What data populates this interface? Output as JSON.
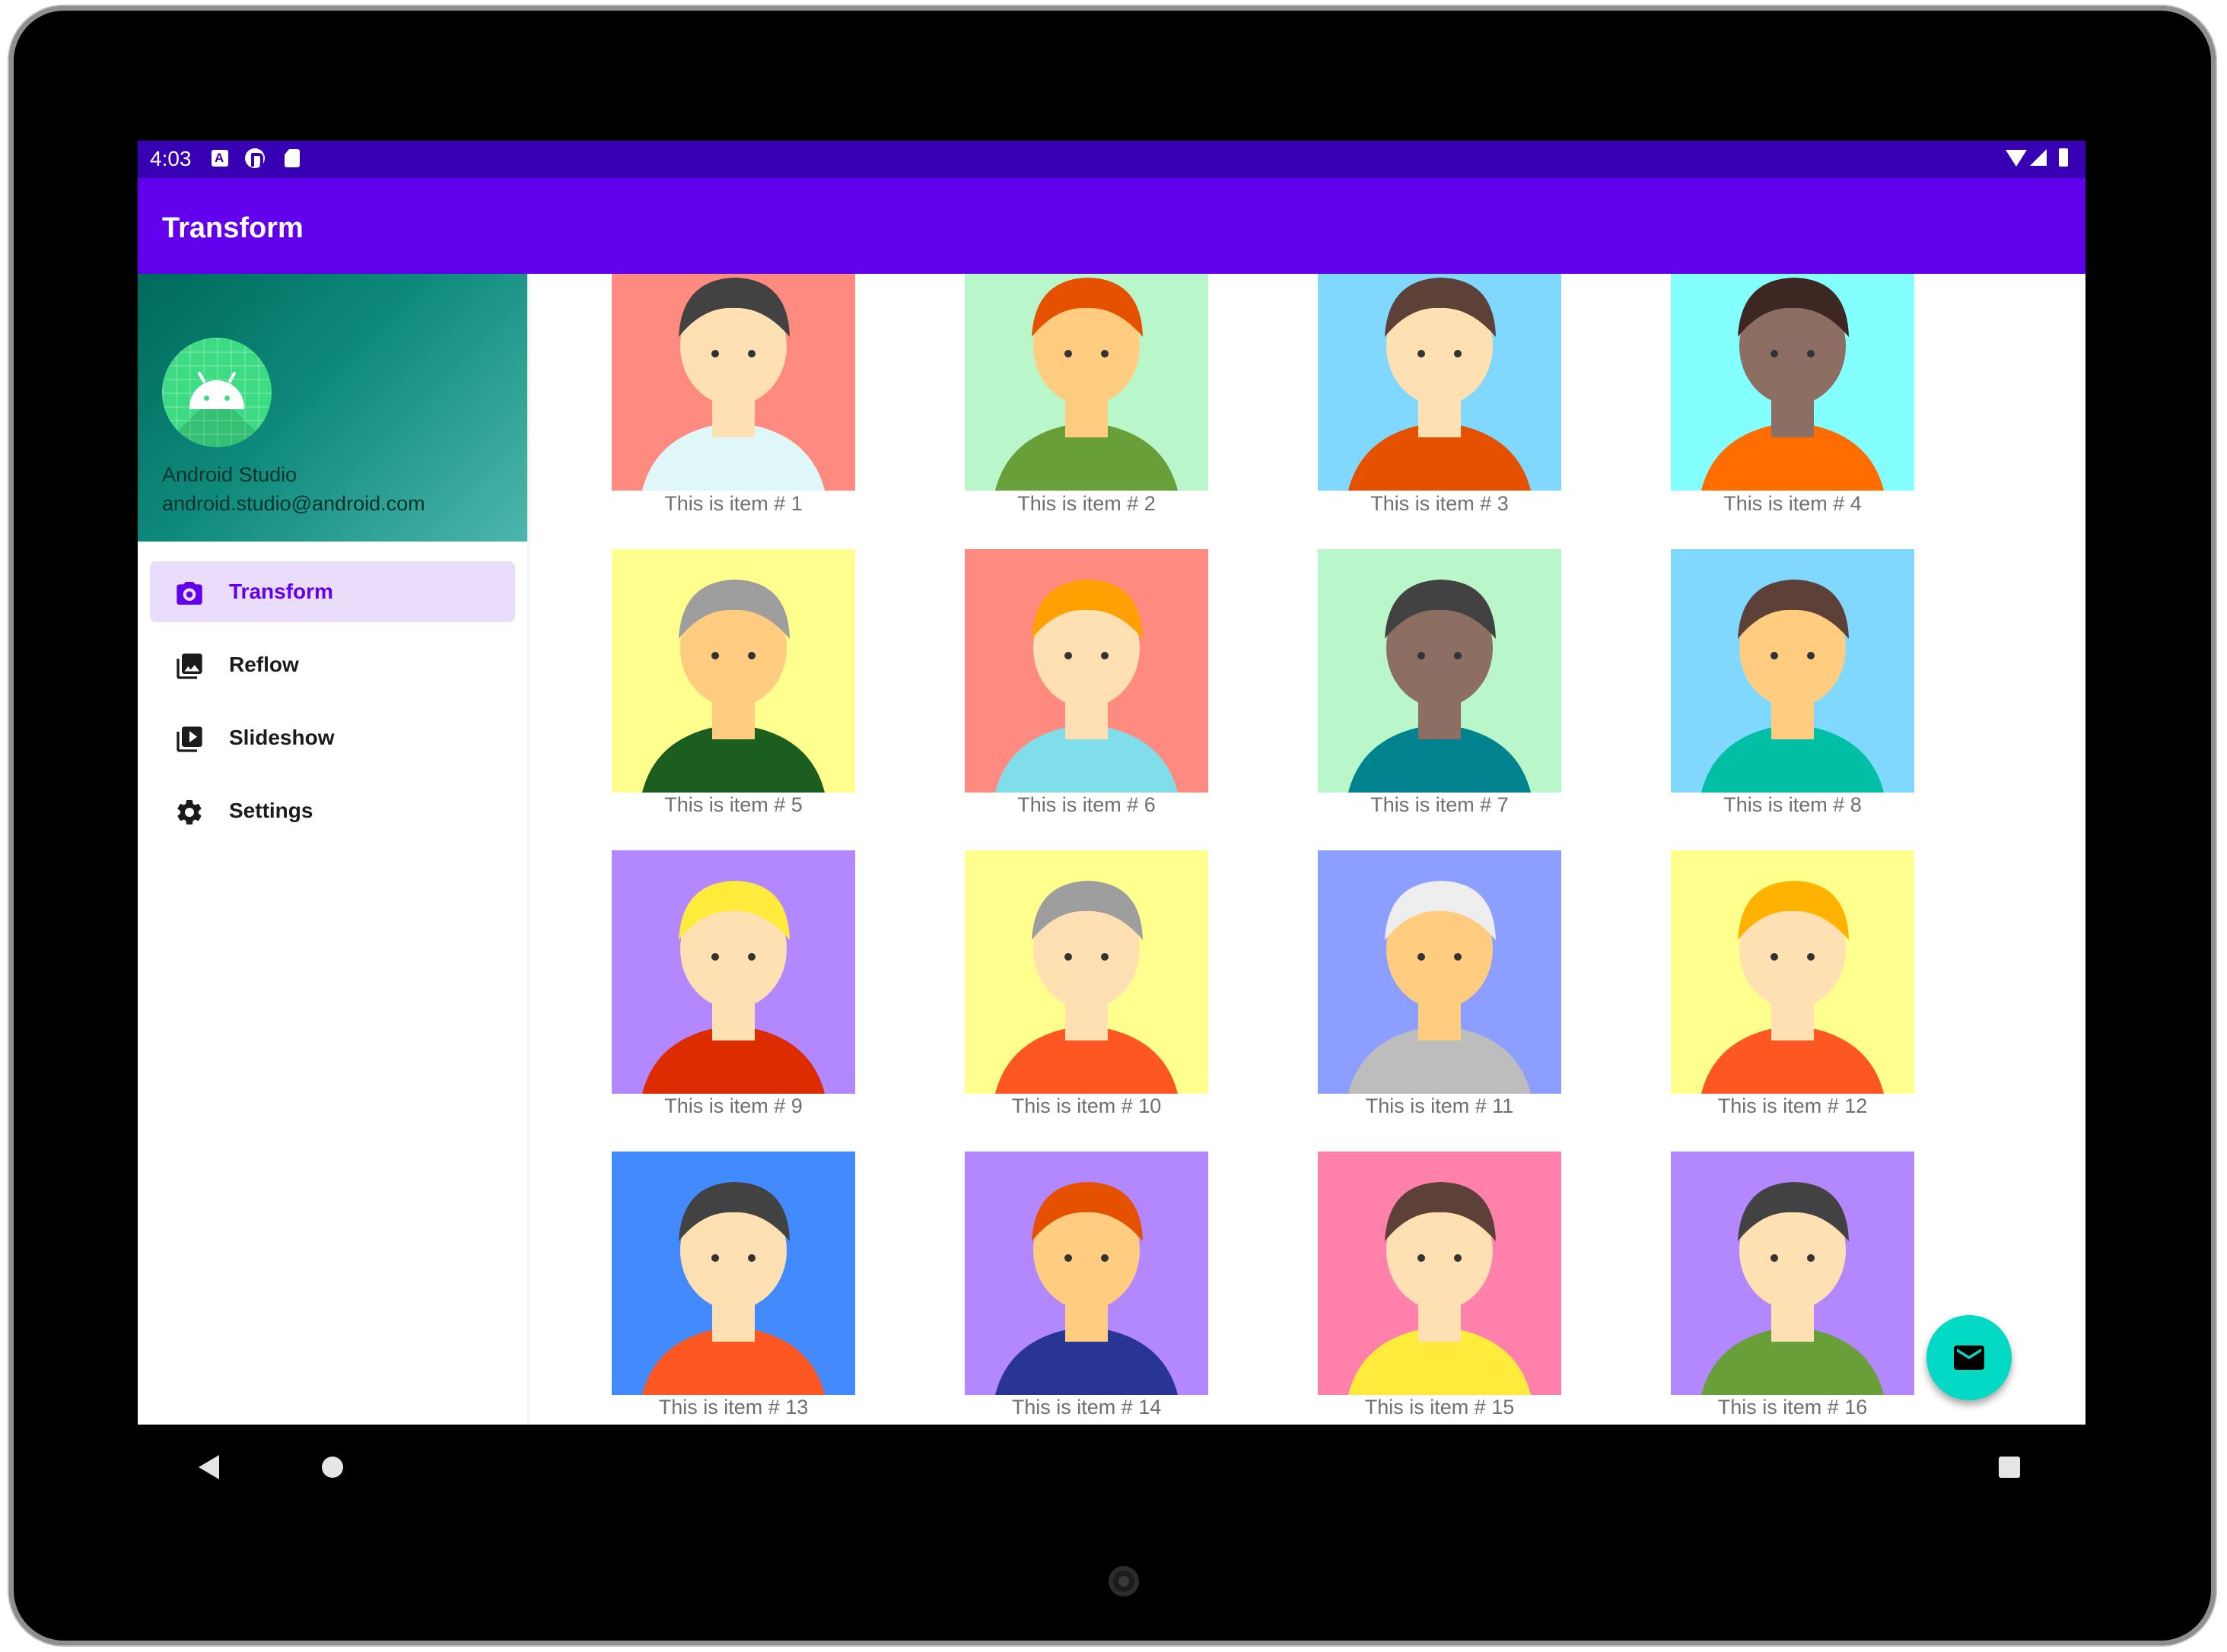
{
  "status_bar": {
    "time": "4:03",
    "left_icons": [
      "text-a-icon",
      "app-p-icon",
      "sd-card-icon"
    ],
    "right_icons": [
      "wifi-icon",
      "signal-icon",
      "battery-icon"
    ]
  },
  "app_bar": {
    "title": "Transform"
  },
  "drawer": {
    "header": {
      "name": "Android Studio",
      "email": "android.studio@android.com"
    },
    "items": [
      {
        "label": "Transform",
        "icon": "camera-icon",
        "selected": true
      },
      {
        "label": "Reflow",
        "icon": "image-icon",
        "selected": false
      },
      {
        "label": "Slideshow",
        "icon": "slideshow-icon",
        "selected": false
      },
      {
        "label": "Settings",
        "icon": "gear-icon",
        "selected": false
      }
    ]
  },
  "grid": {
    "items": [
      {
        "caption": "This is item # 1",
        "bg": "#ff8a80"
      },
      {
        "caption": "This is item # 2",
        "bg": "#b9f6ca"
      },
      {
        "caption": "This is item # 3",
        "bg": "#80d8ff"
      },
      {
        "caption": "This is item # 4",
        "bg": "#84ffff"
      },
      {
        "caption": "This is item # 5",
        "bg": "#ffff8d"
      },
      {
        "caption": "This is item # 6",
        "bg": "#ff8a80"
      },
      {
        "caption": "This is item # 7",
        "bg": "#b9f6ca"
      },
      {
        "caption": "This is item # 8",
        "bg": "#80d8ff"
      },
      {
        "caption": "This is item # 9",
        "bg": "#b388ff"
      },
      {
        "caption": "This is item # 10",
        "bg": "#ffff8d"
      },
      {
        "caption": "This is item # 11",
        "bg": "#8c9eff"
      },
      {
        "caption": "This is item # 12",
        "bg": "#ffff8d"
      },
      {
        "caption": "This is item # 13",
        "bg": "#448aff"
      },
      {
        "caption": "This is item # 14",
        "bg": "#b388ff"
      },
      {
        "caption": "This is item # 15",
        "bg": "#ff80ab"
      },
      {
        "caption": "This is item # 16",
        "bg": "#b388ff"
      }
    ]
  },
  "fab": {
    "icon": "email-icon",
    "color": "#03dac5"
  },
  "nav_bar": {
    "icons": [
      "back-icon",
      "home-icon",
      "recents-icon"
    ]
  },
  "colors": {
    "primary": "#6200ee",
    "primary_dark": "#3700b3",
    "accent": "#03dac5"
  }
}
